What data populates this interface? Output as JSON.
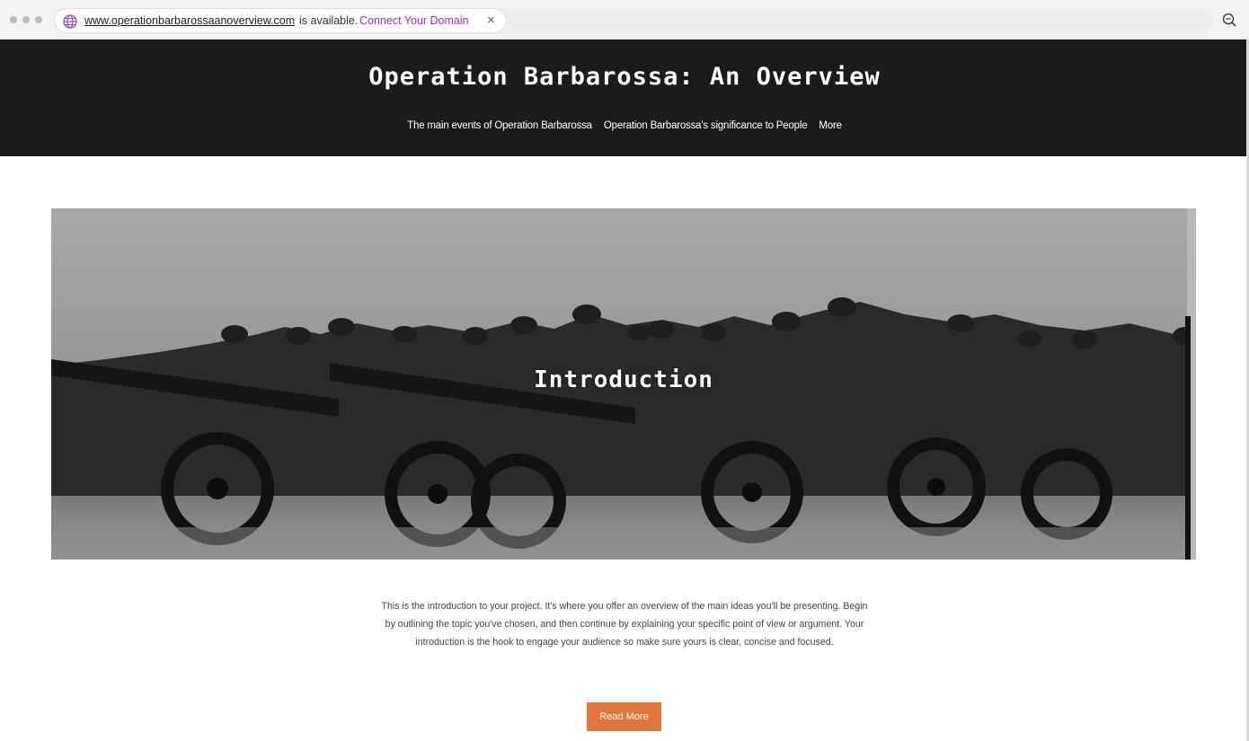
{
  "browser": {
    "domain_url": "www.operationbarbarossaanoverview.com",
    "availability_text": "is available.",
    "connect_link": "Connect Your Domain",
    "close_glyph": "×",
    "icons": [
      "globe-icon",
      "close-icon",
      "zoom-icon"
    ]
  },
  "header": {
    "site_title": "Operation Barbarossa: An Overview",
    "nav": [
      {
        "label": "The main events of Operation Barbarossa"
      },
      {
        "label": "Operation Barbarossa's significance to People"
      },
      {
        "label": "More"
      }
    ]
  },
  "hero": {
    "title": "Introduction"
  },
  "intro": {
    "text": "This is the introduction to your project. It's where you offer an overview of the main ideas you'll be presenting. Begin by outlining the topic you've chosen, and then continue by explaining your specific point of view or argument. Your introduction is the hook to engage your audience so make sure yours is clear, concise and focused."
  },
  "cta": {
    "label": "Read More"
  },
  "colors": {
    "header_bg": "#1b1b1b",
    "accent_button": "#e2773b",
    "domain_link": "#9b2fc2"
  }
}
